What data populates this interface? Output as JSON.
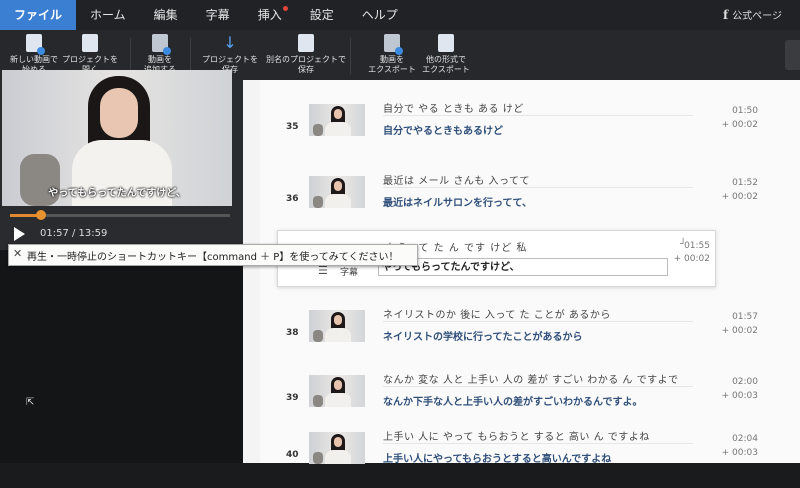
{
  "menu": {
    "items": [
      {
        "label": "ファイル",
        "active": true
      },
      {
        "label": "ホーム"
      },
      {
        "label": "編集"
      },
      {
        "label": "字幕"
      },
      {
        "label": "挿入",
        "badge": true
      },
      {
        "label": "設定"
      },
      {
        "label": "ヘルプ"
      }
    ],
    "facebook_label": "公式ページ"
  },
  "toolbar": {
    "new_video_line1": "新しい動画で",
    "new_video_line2": "始める",
    "open_project_line1": "プロジェクトを",
    "open_project_line2": "開く",
    "add_video_line1": "動画を",
    "add_video_line2": "追加する",
    "save_project_line1": "プロジェクトを",
    "save_project_line2": "保存",
    "save_as_line1": "別名のプロジェクトで",
    "save_as_line2": "保存",
    "export_video_line1": "動画を",
    "export_video_line2": "エクスポート",
    "export_other_line1": "他の形式で",
    "export_other_line2": "エクスポート"
  },
  "player": {
    "subtitle": "やってもらってたんですけど、",
    "time": "01:57 / 13:59",
    "progress_fraction": 0.14
  },
  "tooltip": {
    "text": "再生・一時停止のショートカットキー【command ＋ P】を使ってみてください！"
  },
  "subtitles": {
    "rows": [
      {
        "num": "35",
        "orig": "自分で やる ときも ある けど",
        "trans": "自分でやるときもあるけど",
        "ts": "01:50",
        "dur": "+ 00:02"
      },
      {
        "num": "36",
        "orig": "最近は メール さんも 入ってて",
        "trans": "最近はネイルサロンを行ってて、",
        "ts": "01:52",
        "dur": "+ 00:02"
      },
      {
        "num": "38",
        "orig": "ネイリストのか 後に 入って た ことが あるから",
        "trans": "ネイリストの学校に行ってたことがあるから",
        "ts": "01:57",
        "dur": "+ 00:02"
      },
      {
        "num": "39",
        "orig": "なんか 変な 人と 上手い 人の 差が すごい わかる ん ですよで",
        "trans": "なんか下手な人と上手い人の差がすごいわかるんですよ。",
        "ts": "02:00",
        "dur": "+ 00:03"
      },
      {
        "num": "40",
        "orig": "上手い 人に やって もらおうと すると 高い ん ですよね",
        "trans": "上手い人にやってもらおうとすると高いんですよね",
        "ts": "02:04",
        "dur": "+ 00:03"
      }
    ],
    "active": {
      "orig": "もらって た ん です けど 私",
      "label": "字幕",
      "value": "やってもらってたんですけど、",
      "ts": "01:55",
      "dur": "+ 00:02"
    }
  }
}
